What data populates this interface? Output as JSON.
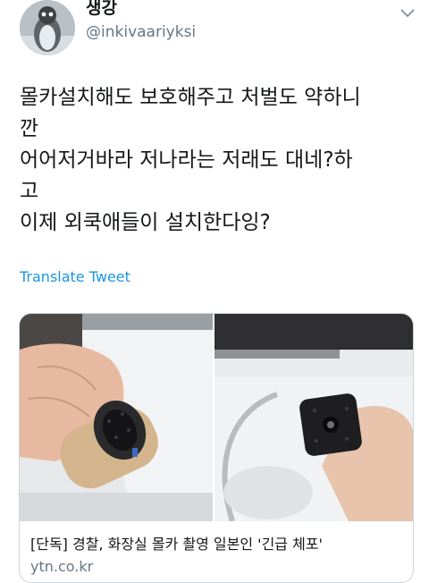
{
  "user": {
    "display_name": "생강",
    "handle": "@inkivaariyksi"
  },
  "tweet": {
    "lines": [
      "몰카설치해도 보호해주고 처벌도 약하니",
      "깐",
      "어어저거바라 저나라는 저래도 대네?하",
      "고",
      "이제 외쿡애들이 설치한다잉?"
    ],
    "translate_label": "Translate Tweet"
  },
  "card": {
    "title": "[단독] 경찰, 화장실 몰카 촬영 일본인 '긴급 체포'",
    "domain": "ytn.co.kr"
  },
  "icons": {
    "menu": "chevron-down-icon"
  },
  "colors": {
    "link": "#1b95e0",
    "secondary_text": "#657786",
    "border": "#ccd6dd"
  }
}
